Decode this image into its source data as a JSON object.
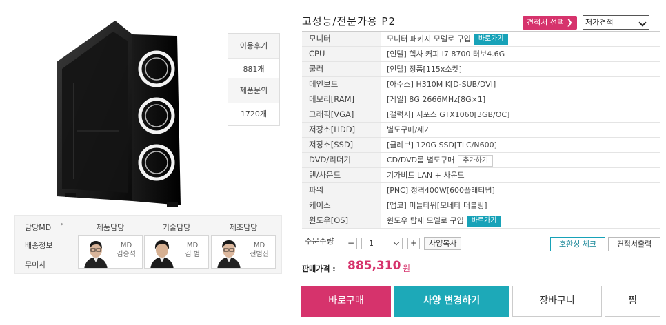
{
  "product": {
    "title": "고성능/전문가용 P2",
    "image": "gaming-pc-case-icon"
  },
  "reviews": [
    {
      "label": "이용후기",
      "count": "881개"
    },
    {
      "label": "제품문의",
      "count": "1720개"
    }
  ],
  "quote": {
    "button_label": "견적서 선택 ❯",
    "select_value": "저가견적"
  },
  "specs": [
    {
      "key": "모니터",
      "value": "모니터 패키지 모델로 구입",
      "tag": "바로가기",
      "tag_style": "blue"
    },
    {
      "key": "CPU",
      "value": "[인텔] 헥사 커피 i7 8700 터보4.6G"
    },
    {
      "key": "쿨러",
      "value": "[인텔] 정품[115x소켓]"
    },
    {
      "key": "메인보드",
      "value": "[아수스] H310M K[D-SUB/DVI]"
    },
    {
      "key": "메모리[RAM]",
      "value": "[게일] 8G 2666MHz[8G×1]"
    },
    {
      "key": "그래픽[VGA]",
      "value": "[갤럭시] 지포스 GTX1060[3GB/OC]"
    },
    {
      "key": "저장소[HDD]",
      "value": "별도구매/제거"
    },
    {
      "key": "저장소[SSD]",
      "value": "[클레브] 120G SSD[TLC/N600]"
    },
    {
      "key": "DVD/리더기",
      "value": "CD/DVD롬 별도구매",
      "tag": "추가하기",
      "tag_style": "gray"
    },
    {
      "key": "랜/사운드",
      "value": "기가비트 LAN + 사운드"
    },
    {
      "key": "파워",
      "value": "[PNC] 정격400W[600플래티넘]"
    },
    {
      "key": "케이스",
      "value": "[앱코] 미들타워[모네타 더블링]"
    },
    {
      "key": "윈도우[OS]",
      "value": "윈도우 탑재 모델로 구입",
      "tag": "바로가기",
      "tag_style": "blue"
    }
  ],
  "quantity": {
    "label": "주문수량",
    "minus": "−",
    "value": "1",
    "plus": "+",
    "copy_label": "사양복사"
  },
  "actions": {
    "compat_label": "호환성 체크",
    "print_label": "견적서출력",
    "buy_label": "바로구매",
    "change_label": "사양 변경하기",
    "cart_label": "장바구니",
    "wish_label": "찜"
  },
  "price": {
    "label": "판매가격 :",
    "value": "885,310",
    "unit": "원"
  },
  "staff": {
    "left_labels": [
      "담당MD",
      "배송정보",
      "무이자"
    ],
    "arrow": "▸",
    "members": [
      {
        "role": "제품담당",
        "title": "MD",
        "name": "김승석"
      },
      {
        "role": "기술담당",
        "title": "MD",
        "name": "김 범"
      },
      {
        "role": "제조담당",
        "title": "MD",
        "name": "전범진"
      }
    ]
  },
  "colors": {
    "accent_pink": "#d6336c",
    "accent_teal": "#1da9b8"
  }
}
